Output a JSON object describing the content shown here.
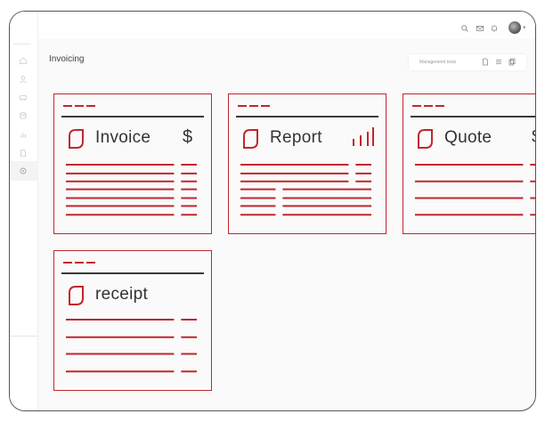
{
  "app": {
    "page_title": "Invoicing"
  },
  "toolbar": {
    "label": "Management tools",
    "icons": [
      "document-icon",
      "stack-icon",
      "copy-icon"
    ]
  },
  "topbar": {
    "icons": [
      "search-icon",
      "mail-icon",
      "bell-icon",
      "avatar",
      "chevron-down-icon"
    ]
  },
  "sidebar": {
    "items": [
      "home-icon",
      "user-icon",
      "car-icon",
      "database-icon",
      "chart-icon",
      "file-icon",
      "settings-icon"
    ],
    "selected": "settings-icon"
  },
  "cards": [
    {
      "title": "Invoice",
      "symbol": "$",
      "symbol_icon": "dollar-icon"
    },
    {
      "title": "Report",
      "symbol_icon": "bar-chart-icon"
    },
    {
      "title": "Quote",
      "symbol": "$",
      "symbol_icon": "dollar-icon"
    },
    {
      "title": "receipt"
    }
  ],
  "colors": {
    "accent": "#c0272d",
    "rule": "#3a3a3a",
    "background": "#fafafa"
  }
}
